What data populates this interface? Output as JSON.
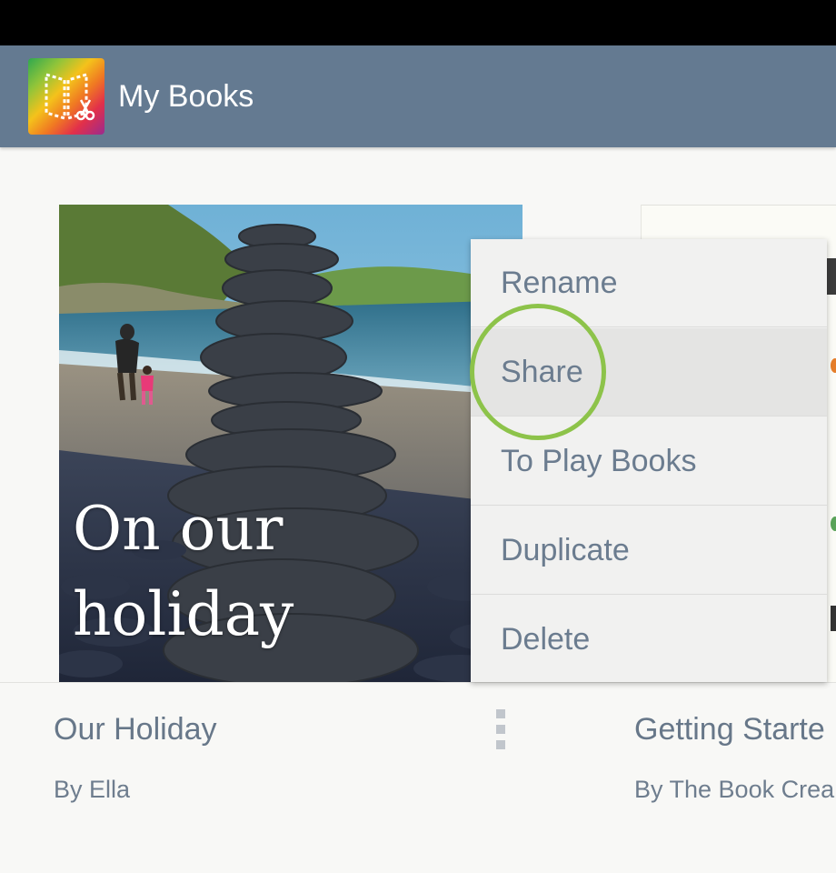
{
  "app_bar": {
    "title": "My Books",
    "icon": "book-creator-icon"
  },
  "books": [
    {
      "cover_title": "On our holiday",
      "title": "Our Holiday",
      "author": "By Ella"
    },
    {
      "title": "Getting Starte",
      "author": "By The Book Crea"
    }
  ],
  "context_menu": {
    "items": [
      {
        "label": "Rename"
      },
      {
        "label": "Share"
      },
      {
        "label": "To Play Books"
      },
      {
        "label": "Duplicate"
      },
      {
        "label": "Delete"
      }
    ],
    "highlighted": "Share"
  },
  "colors": {
    "app_bar": "#647a91",
    "highlight_ring": "#8dc34a",
    "menu_background": "#f1f1f0",
    "text": "#677789"
  }
}
